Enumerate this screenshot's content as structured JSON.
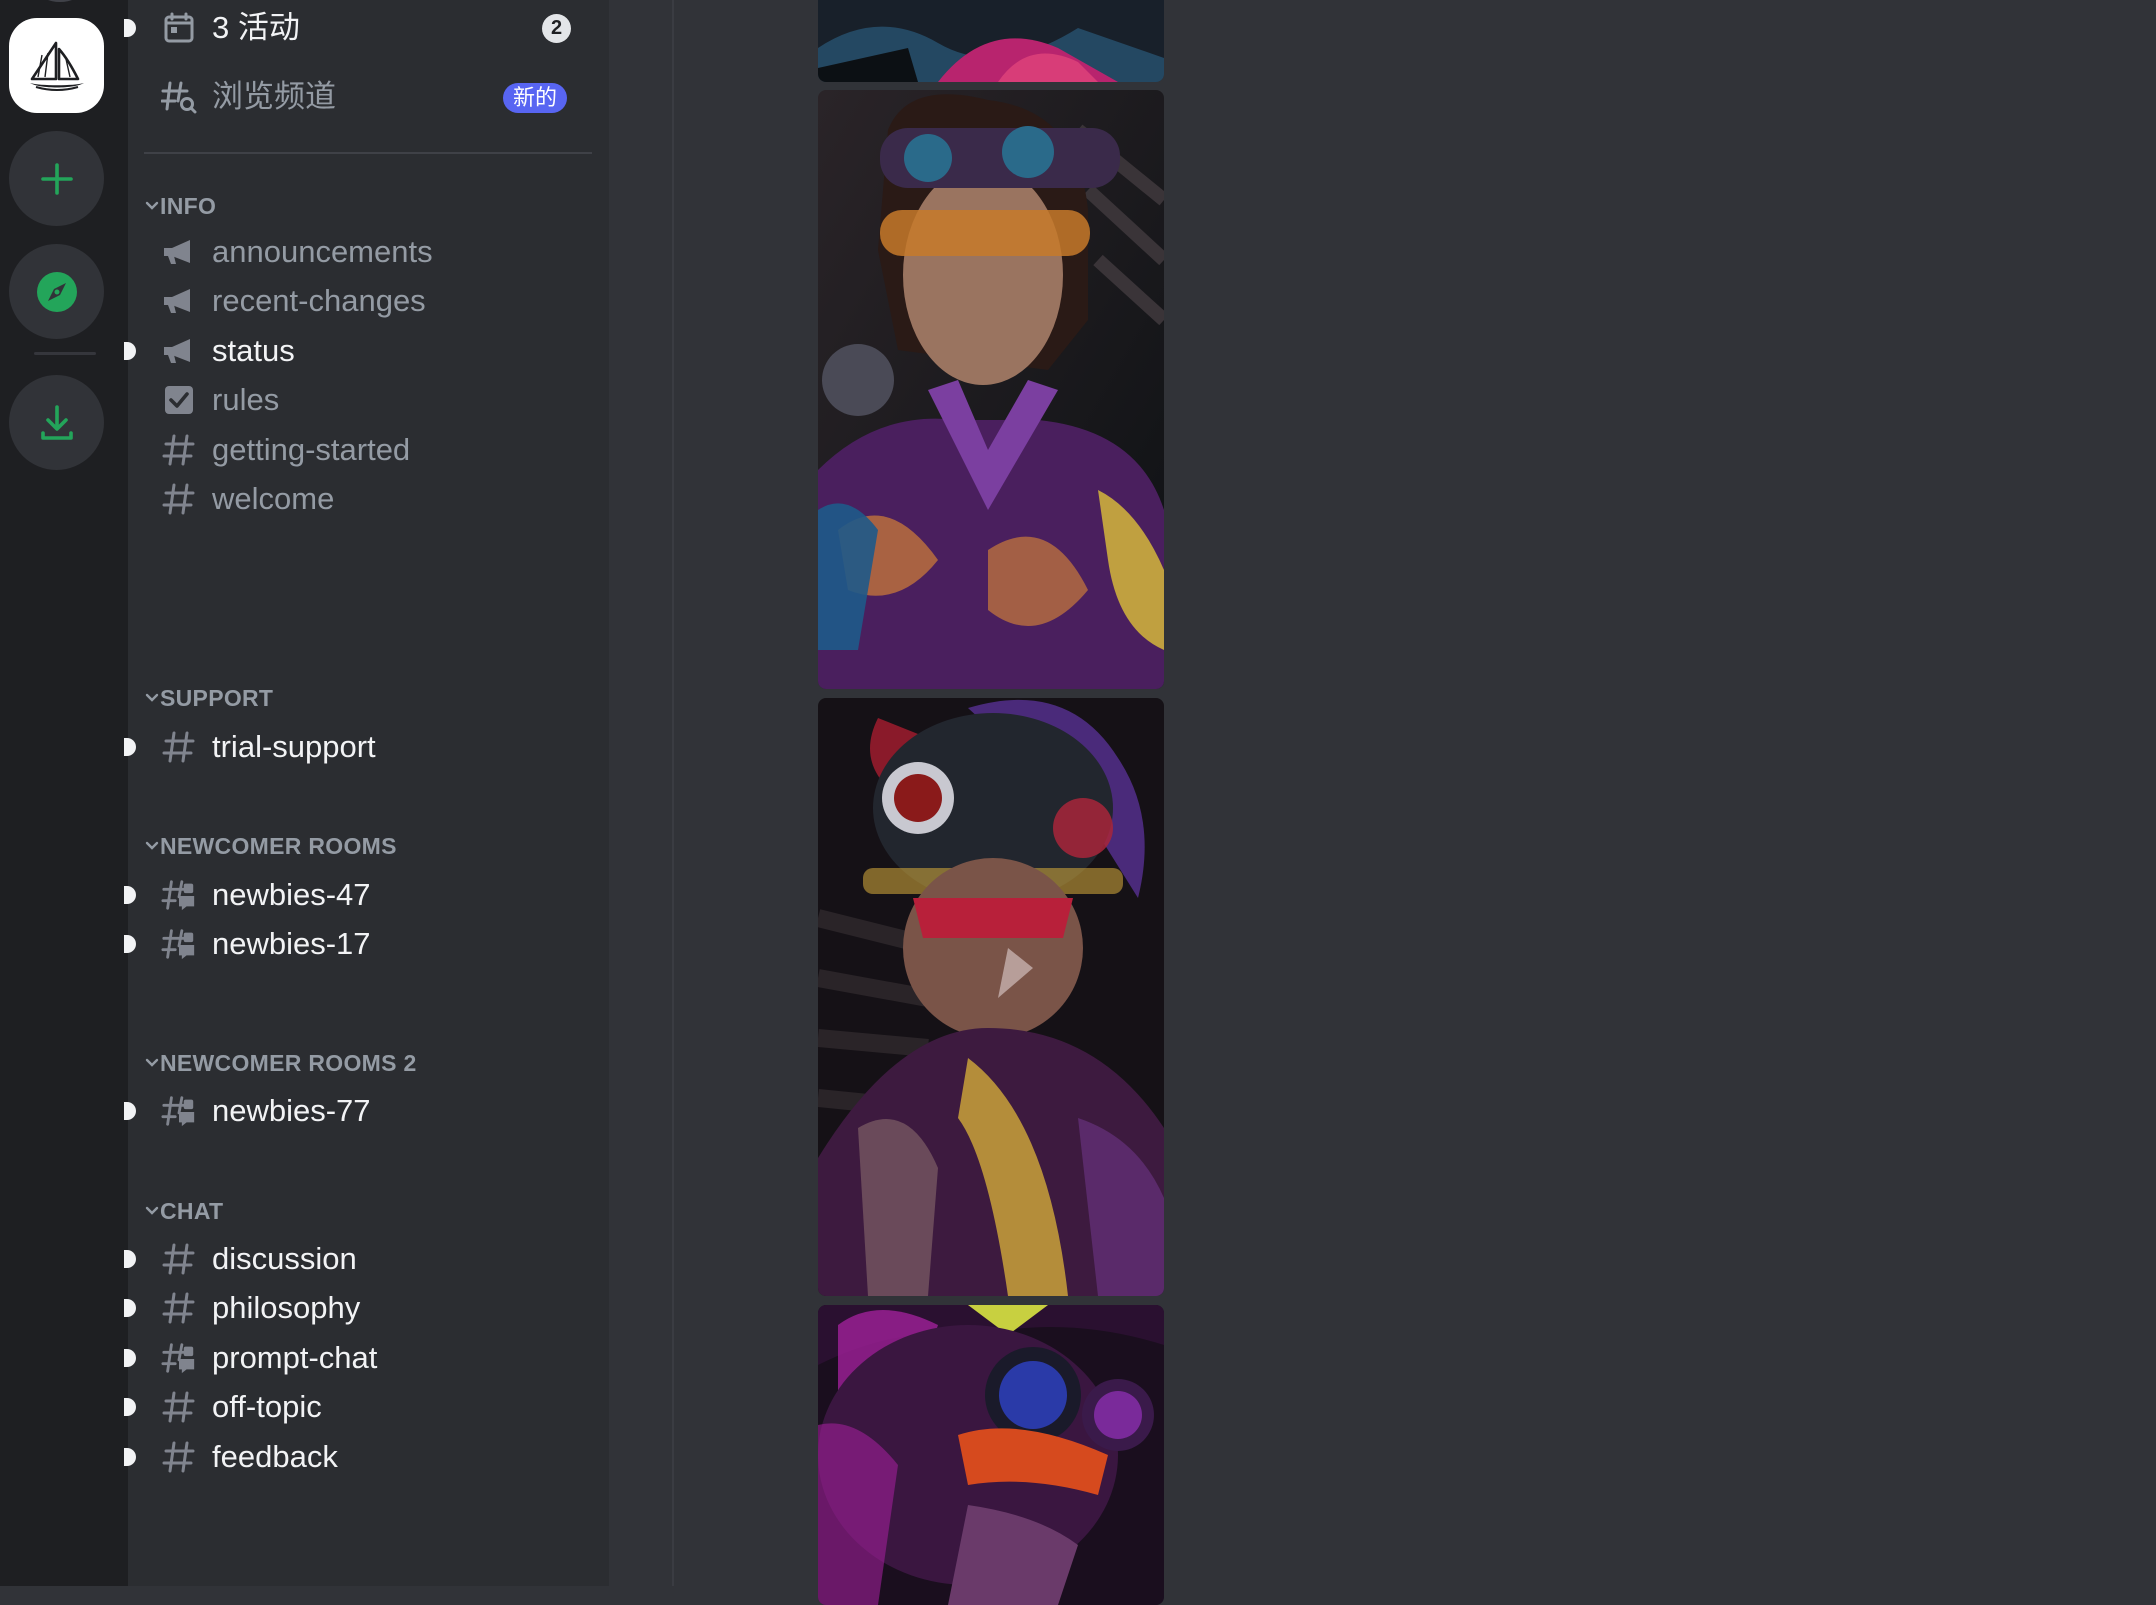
{
  "rail": {
    "server_name": "Midjourney",
    "items": [
      {
        "name": "server-midjourney",
        "icon": "sailboat-icon"
      },
      {
        "name": "add-server-button",
        "icon": "plus-icon"
      },
      {
        "name": "explore-servers-button",
        "icon": "compass-icon"
      },
      {
        "name": "download-apps-button",
        "icon": "download-icon"
      }
    ],
    "accent": "#23a55a"
  },
  "channels": {
    "top": [
      {
        "label": "3 活动",
        "icon": "calendar-icon",
        "badge": "2",
        "unread": true
      },
      {
        "label": "浏览频道",
        "icon": "browse-channels-icon",
        "badge_new": "新的",
        "unread": false
      }
    ],
    "categories": [
      {
        "label": "INFO",
        "items": [
          {
            "label": "announcements",
            "icon": "megaphone-icon",
            "unread": false
          },
          {
            "label": "recent-changes",
            "icon": "megaphone-icon",
            "unread": false
          },
          {
            "label": "status",
            "icon": "megaphone-icon",
            "unread": true
          },
          {
            "label": "rules",
            "icon": "checkbox-icon",
            "unread": false
          },
          {
            "label": "getting-started",
            "icon": "hash-icon",
            "unread": false
          },
          {
            "label": "welcome",
            "icon": "hash-icon",
            "unread": false
          }
        ]
      },
      {
        "label": "SUPPORT",
        "items": [
          {
            "label": "trial-support",
            "icon": "hash-icon",
            "unread": true
          }
        ]
      },
      {
        "label": "NEWCOMER ROOMS",
        "items": [
          {
            "label": "newbies-47",
            "icon": "hash-thread-icon",
            "unread": true
          },
          {
            "label": "newbies-17",
            "icon": "hash-thread-icon",
            "unread": true
          }
        ]
      },
      {
        "label": "NEWCOMER ROOMS 2",
        "items": [
          {
            "label": "newbies-77",
            "icon": "hash-thread-icon",
            "unread": true
          }
        ]
      },
      {
        "label": "CHAT",
        "items": [
          {
            "label": "discussion",
            "icon": "hash-icon",
            "unread": true
          },
          {
            "label": "philosophy",
            "icon": "hash-icon",
            "unread": true
          },
          {
            "label": "prompt-chat",
            "icon": "hash-thread-icon",
            "unread": true
          },
          {
            "label": "off-topic",
            "icon": "hash-icon",
            "unread": true
          },
          {
            "label": "feedback",
            "icon": "hash-icon",
            "unread": true
          }
        ]
      }
    ]
  },
  "main": {
    "attachments": [
      {
        "name": "image-attachment-1",
        "palette": [
          "#1c2a3a",
          "#3a1838",
          "#b8246e",
          "#2a6a8a"
        ]
      },
      {
        "name": "image-attachment-2",
        "palette": [
          "#12161c",
          "#4a1f5e",
          "#7b3fa0",
          "#c97a3a"
        ]
      },
      {
        "name": "image-attachment-3",
        "palette": [
          "#140f18",
          "#3d1a3f",
          "#a8263a",
          "#c9a23a"
        ]
      },
      {
        "name": "image-attachment-4",
        "palette": [
          "#2a0c2e",
          "#a0209a",
          "#d64a1e",
          "#2a3aa8"
        ]
      }
    ]
  }
}
